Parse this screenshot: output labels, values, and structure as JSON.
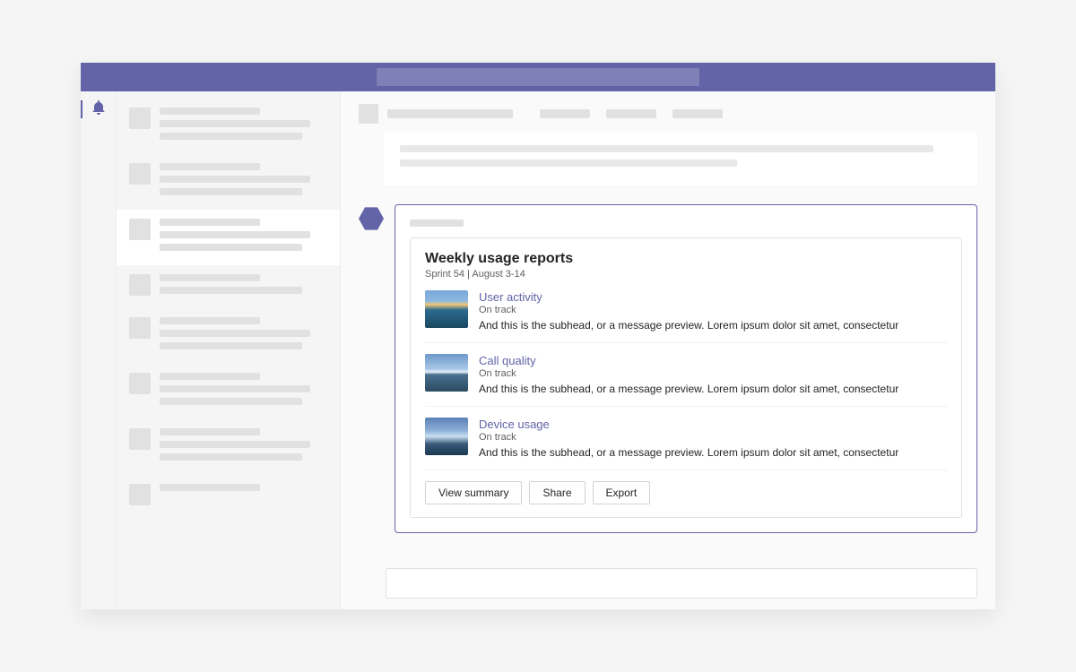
{
  "colors": {
    "brand": "#6264a7"
  },
  "rail": {
    "active": "activity"
  },
  "card": {
    "title": "Weekly usage reports",
    "subtitle": "Sprint 54  |  August 3-14",
    "reports": [
      {
        "link": "User activity",
        "status": "On track",
        "preview": "And this is the subhead, or a message preview. Lorem ipsum dolor sit amet, consectetur"
      },
      {
        "link": "Call quality",
        "status": "On track",
        "preview": "And this is the subhead, or a message preview. Lorem ipsum dolor sit amet, consectetur"
      },
      {
        "link": "Device usage",
        "status": "On track",
        "preview": "And this is the subhead, or a message preview. Lorem ipsum dolor sit amet, consectetur"
      }
    ],
    "actions": {
      "view": "View summary",
      "share": "Share",
      "export": "Export"
    }
  }
}
